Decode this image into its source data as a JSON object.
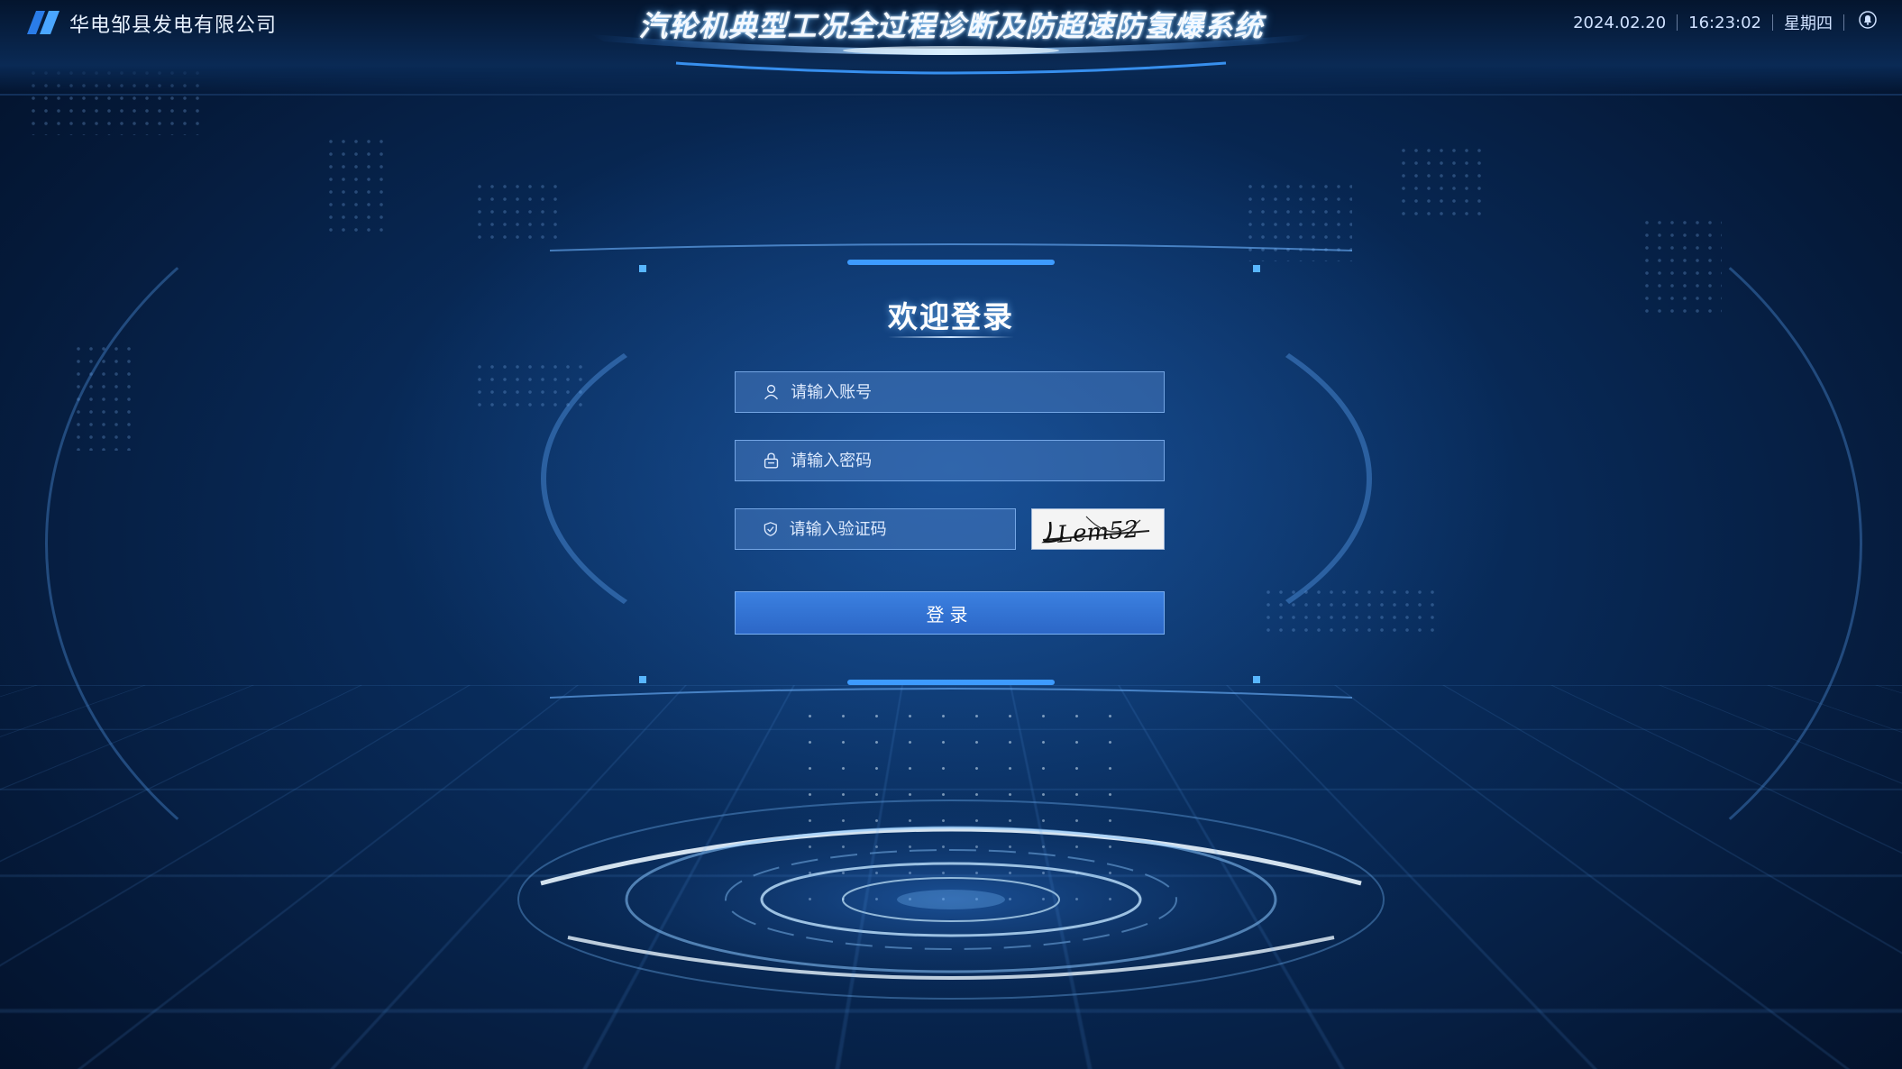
{
  "header": {
    "company_name": "华电邹县发电有限公司",
    "system_title": "汽轮机典型工况全过程诊断及防超速防氢爆系统",
    "date": "2024.02.20",
    "time": "16:23:02",
    "weekday": "星期四"
  },
  "login": {
    "welcome_title": "欢迎登录",
    "account_placeholder": "请输入账号",
    "password_placeholder": "请输入密码",
    "captcha_placeholder": "请输入验证码",
    "captcha_text": "Lem52",
    "submit_label": "登录"
  },
  "icons": {
    "logo": "brand-logo-icon",
    "notification": "bell-icon",
    "account": "user-icon",
    "password": "lock-icon",
    "captcha": "shield-icon"
  },
  "colors": {
    "background": "#061b3a",
    "accent": "#3b80e0",
    "field_bg": "#4678be",
    "text": "#ffffff"
  }
}
